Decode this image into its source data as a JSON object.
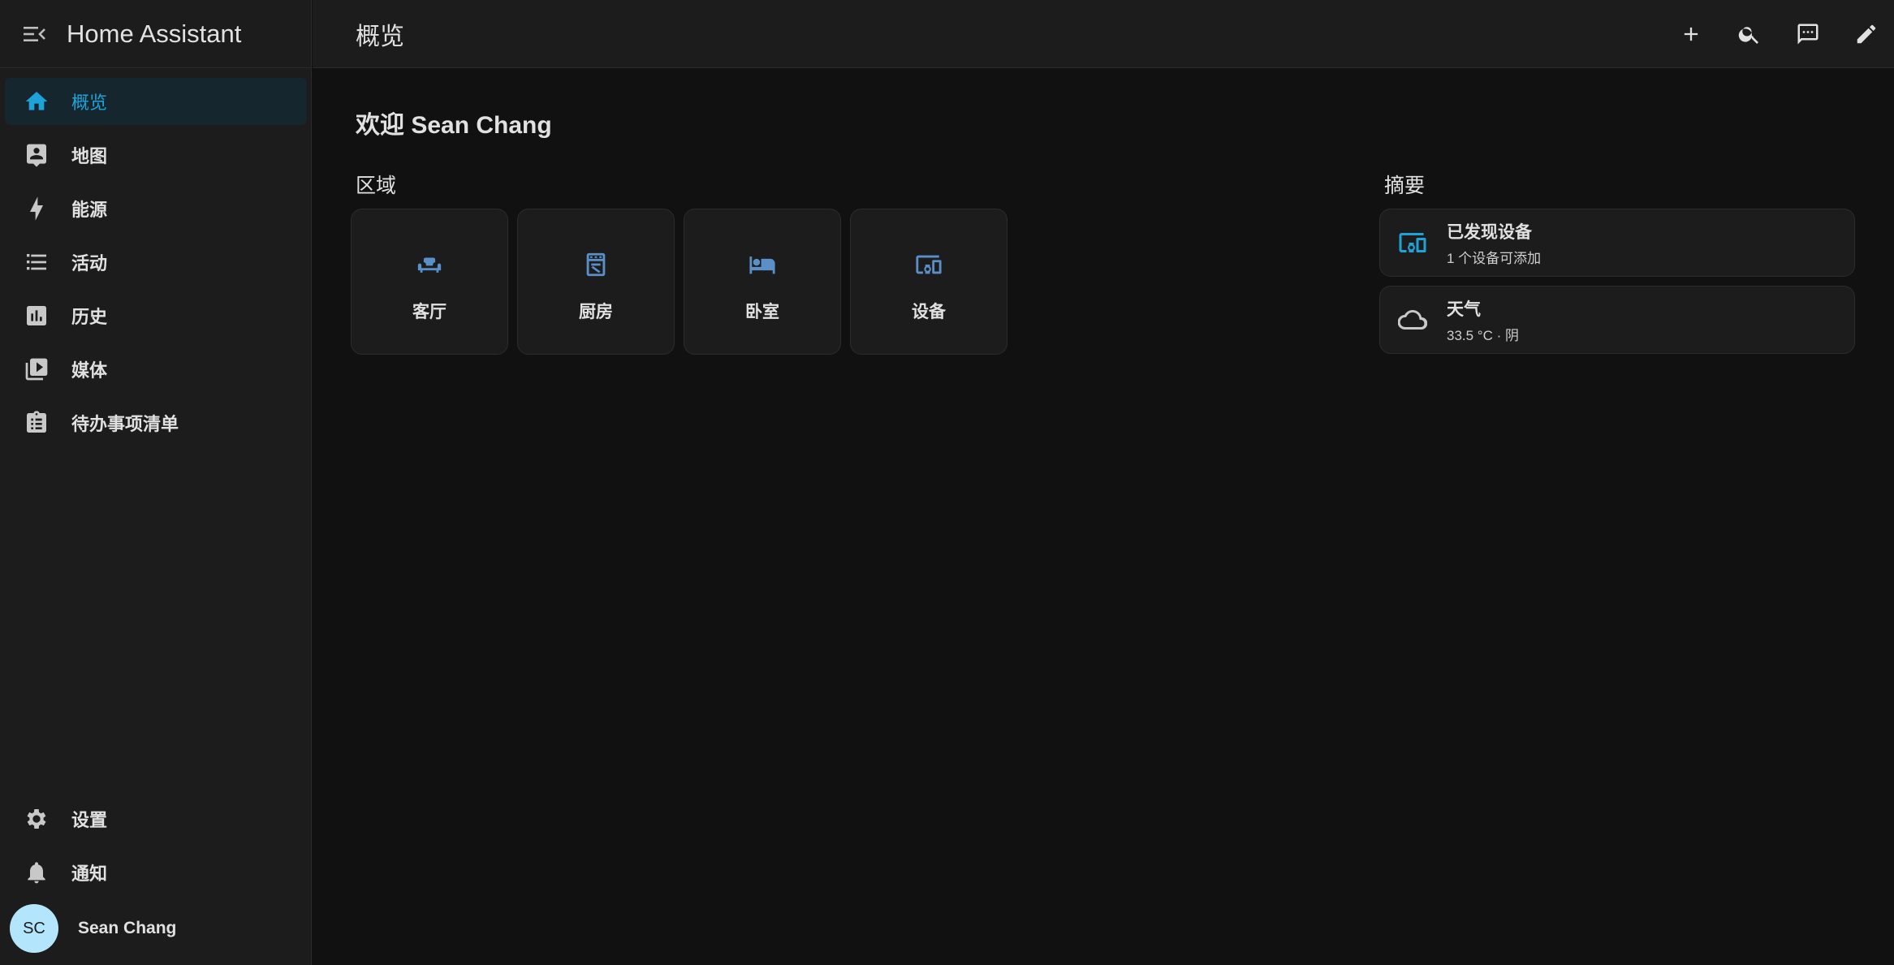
{
  "app": {
    "title": "Home Assistant"
  },
  "sidebar": {
    "items": [
      {
        "label": "概览",
        "icon": "home-icon"
      },
      {
        "label": "地图",
        "icon": "map-icon"
      },
      {
        "label": "能源",
        "icon": "lightning-icon"
      },
      {
        "label": "活动",
        "icon": "list-icon"
      },
      {
        "label": "历史",
        "icon": "chart-icon"
      },
      {
        "label": "媒体",
        "icon": "media-icon"
      },
      {
        "label": "待办事项清单",
        "icon": "clipboard-list-icon"
      }
    ],
    "bottom": [
      {
        "label": "设置",
        "icon": "gear-icon"
      },
      {
        "label": "通知",
        "icon": "bell-icon"
      }
    ],
    "user": {
      "initials": "SC",
      "name": "Sean Chang"
    }
  },
  "header": {
    "title": "概览"
  },
  "main": {
    "welcome": "欢迎 Sean Chang",
    "areas_title": "区域",
    "areas": [
      {
        "label": "客厅",
        "icon": "sofa-icon"
      },
      {
        "label": "厨房",
        "icon": "stove-icon"
      },
      {
        "label": "卧室",
        "icon": "bed-icon"
      },
      {
        "label": "设备",
        "icon": "devices-icon"
      }
    ],
    "summary_title": "摘要",
    "summary": [
      {
        "title": "已发现设备",
        "subtitle": "1 个设备可添加",
        "icon": "devices-icon"
      },
      {
        "title": "天气",
        "subtitle": "33.5 °C · 阴",
        "icon": "cloud-icon"
      }
    ]
  },
  "colors": {
    "accent": "#1ea3d9",
    "area_icon": "#5a8fc7",
    "background": "#111111",
    "card": "#1c1c1c"
  }
}
